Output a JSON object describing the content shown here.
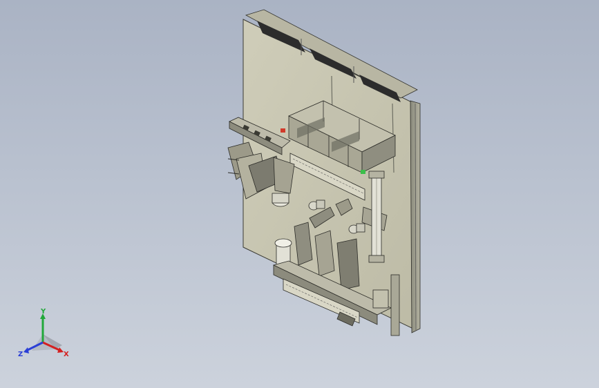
{
  "window": {
    "title": ""
  },
  "viewport": {
    "background_top": "#aab3c4",
    "background_bottom": "#ccd2dc",
    "model": {
      "description_icon": "fixture-assembly-model",
      "plate_color": "#c9c7b4",
      "shadow_color": "#6d6e63",
      "edge_color": "#2a2a26",
      "accent_red": "#d23a2a",
      "accent_green": "#3bbf4a"
    }
  },
  "triad": {
    "x_label": "X",
    "y_label": "Y",
    "z_label": "Z",
    "x_color": "#d42020",
    "y_color": "#21a83a",
    "z_color": "#2b3fd6"
  }
}
